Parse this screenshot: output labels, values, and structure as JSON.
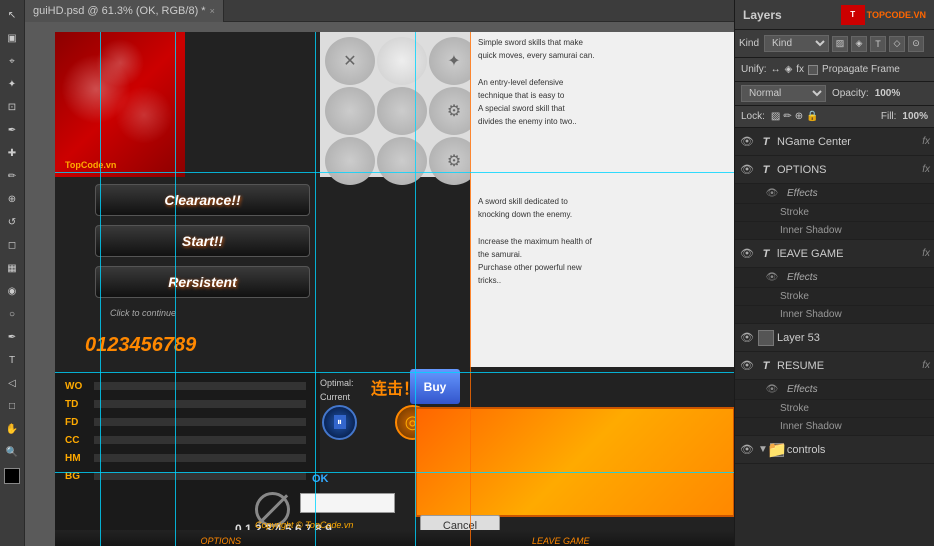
{
  "tab": {
    "filename": "guiHD.psd @ 61.3% (OK, RGB/8) *",
    "close_label": "×"
  },
  "layers_panel": {
    "title": "Layers",
    "kind_label": "Kind",
    "blend_mode": "Normal",
    "opacity_label": "Opacity:",
    "opacity_value": "100%",
    "lock_label": "Lock:",
    "fill_label": "Fill:",
    "fill_value": "100%",
    "unify_label": "Unify:",
    "propagate_label": "Propagate Frame",
    "items": [
      {
        "name": "NGame Center",
        "type": "T",
        "has_fx": true,
        "fx_label": "fx",
        "visible": true,
        "indent": 0
      },
      {
        "name": "OPTIONS",
        "type": "T",
        "has_fx": true,
        "fx_label": "fx",
        "visible": true,
        "indent": 0
      },
      {
        "name": "Effects",
        "type": "effects",
        "visible": true,
        "indent": 1
      },
      {
        "name": "Stroke",
        "type": "effect",
        "visible": true,
        "indent": 2
      },
      {
        "name": "Inner Shadow",
        "type": "effect",
        "visible": true,
        "indent": 2
      },
      {
        "name": "lEAVE GAME",
        "type": "T",
        "has_fx": true,
        "fx_label": "fx",
        "visible": true,
        "indent": 0
      },
      {
        "name": "Effects",
        "type": "effects",
        "visible": true,
        "indent": 1
      },
      {
        "name": "Stroke",
        "type": "effect",
        "visible": true,
        "indent": 2
      },
      {
        "name": "Inner Shadow",
        "type": "effect",
        "visible": true,
        "indent": 2
      },
      {
        "name": "Layer 53",
        "type": "layer",
        "has_fx": false,
        "visible": true,
        "indent": 0
      },
      {
        "name": "RESUME",
        "type": "T",
        "has_fx": true,
        "fx_label": "fx",
        "visible": true,
        "indent": 0
      },
      {
        "name": "Effects",
        "type": "effects",
        "visible": true,
        "indent": 1
      },
      {
        "name": "Stroke",
        "type": "effect",
        "visible": true,
        "indent": 2
      },
      {
        "name": "Inner Shadow",
        "type": "effect",
        "visible": true,
        "indent": 2
      },
      {
        "name": "controls",
        "type": "group",
        "visible": true,
        "indent": 0
      }
    ]
  },
  "canvas": {
    "logo": "TopCode.vn",
    "buttons": [
      "Clearance!!",
      "Start!!",
      "Rersistent"
    ],
    "click_continue": "Click to continue",
    "digits": "0123456789",
    "text_lines": [
      "Simple sword skills that make",
      "quick moves, every samurai can.",
      "",
      "An entry-level defensive",
      "technique that is easy to",
      "A special sword skill that",
      "divides the enemy into two..",
      "",
      "A sword skill dedicated to",
      "knocking down the enemy.",
      "",
      "Increase the maximum health of",
      "the samurai.",
      "Purchase other powerful new",
      "tricks.."
    ],
    "buy_label": "Buy",
    "ok_label": "OK",
    "cancel_label": "Cancel",
    "optimal_label": "Optimal:",
    "current_label": "Current",
    "stats": [
      "WO",
      "TD",
      "FD",
      "CC",
      "HM",
      "BG"
    ],
    "copyright": "Copyright © TopCode.vn",
    "bottom_links": [
      "OPTIONS",
      "LEAVE GAME"
    ]
  },
  "brand": {
    "icon_text": "TC",
    "url": "TOPCODE.VN"
  }
}
